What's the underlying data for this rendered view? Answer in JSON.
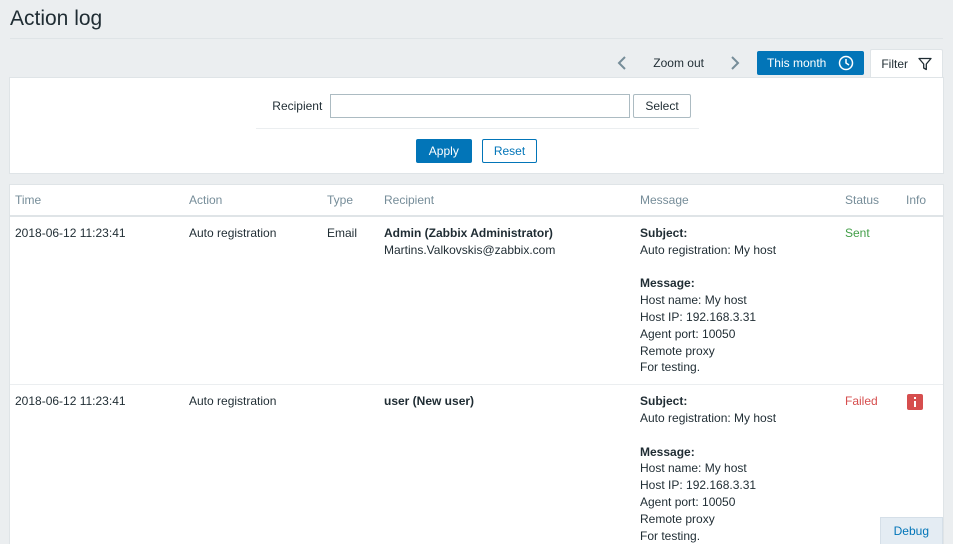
{
  "page": {
    "title": "Action log"
  },
  "toolbar": {
    "zoom_out_label": "Zoom out",
    "period_label": "This month",
    "filter_label": "Filter"
  },
  "filter": {
    "recipient_label": "Recipient",
    "recipient_value": "",
    "select_label": "Select",
    "apply_label": "Apply",
    "reset_label": "Reset"
  },
  "table": {
    "columns": {
      "time": "Time",
      "action": "Action",
      "type": "Type",
      "recipient": "Recipient",
      "message": "Message",
      "status": "Status",
      "info": "Info"
    },
    "rows": [
      {
        "time": "2018-06-12 11:23:41",
        "action": "Auto registration",
        "type": "Email",
        "recipient_name": "Admin (Zabbix Administrator)",
        "recipient_email": "Martins.Valkovskis@zabbix.com",
        "subject_label": "Subject:",
        "subject": "Auto registration: My host",
        "message_label": "Message:",
        "message_lines": [
          "Host name: My host",
          "Host IP: 192.168.3.31",
          "Agent port: 10050",
          "Remote proxy",
          "For testing."
        ],
        "status": "Sent"
      },
      {
        "time": "2018-06-12 11:23:41",
        "action": "Auto registration",
        "type": "",
        "recipient_name": "user (New user)",
        "recipient_email": "",
        "subject_label": "Subject:",
        "subject": "Auto registration: My host",
        "message_label": "Message:",
        "message_lines": [
          "Host name: My host",
          "Host IP: 192.168.3.31",
          "Agent port: 10050",
          "Remote proxy",
          "For testing."
        ],
        "status": "Failed",
        "info_icon": "error-info-icon"
      }
    ]
  },
  "debug": {
    "label": "Debug"
  },
  "colors": {
    "accent": "#0275b8",
    "sent": "#429e47",
    "failed": "#d64e4e",
    "background": "#ebeef0"
  }
}
